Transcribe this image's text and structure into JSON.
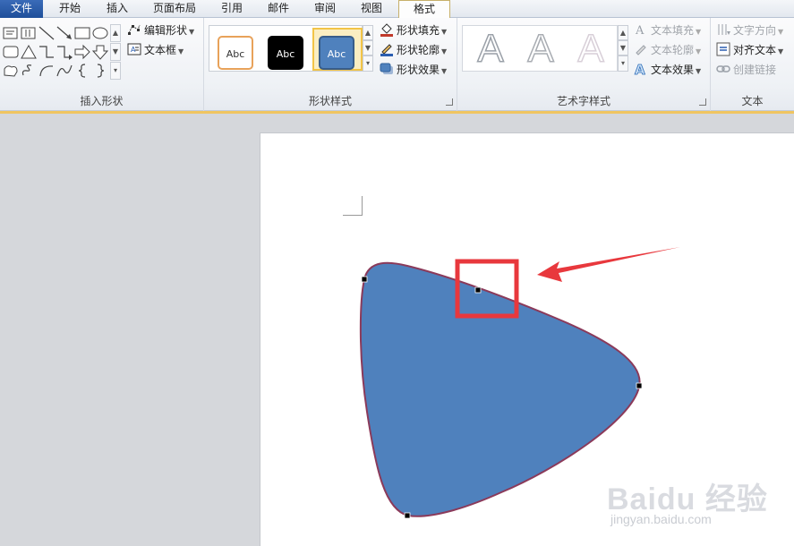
{
  "tabs": [
    {
      "label": "文件"
    },
    {
      "label": "开始"
    },
    {
      "label": "插入"
    },
    {
      "label": "页面布局"
    },
    {
      "label": "引用"
    },
    {
      "label": "邮件"
    },
    {
      "label": "审阅"
    },
    {
      "label": "视图"
    },
    {
      "label": "格式"
    }
  ],
  "active_tab": "格式",
  "groups": {
    "insert_shapes": {
      "title": "插入形状",
      "edit_shape_label": "编辑形状",
      "text_box_label": "文本框"
    },
    "shape_styles": {
      "title": "形状样式",
      "swatches": [
        {
          "label": "Abc",
          "fill": "#ffffff",
          "border": "#e8a25a",
          "text": "#333333"
        },
        {
          "label": "Abc",
          "fill": "#000000",
          "border": "#000000",
          "text": "#ffffff"
        },
        {
          "label": "Abc",
          "fill": "#4f81bd",
          "border": "#385d8a",
          "text": "#ffffff"
        }
      ],
      "fill_label": "形状填充",
      "outline_label": "形状轮廓",
      "effects_label": "形状效果"
    },
    "wordart_styles": {
      "title": "艺术字样式",
      "sample_letter": "A",
      "text_fill_label": "文本填充",
      "text_outline_label": "文本轮廓",
      "text_effects_label": "文本效果"
    },
    "text": {
      "title": "文本",
      "direction_label": "文字方向",
      "align_label": "对齐文本",
      "link_label": "创建链接"
    }
  },
  "document": {
    "shape_fill": "#4f81bd",
    "shape_outline": "#8b3a5a",
    "highlight_color": "#e8383d"
  },
  "watermark": {
    "brand": "Baidu 经验",
    "url": "jingyan.baidu.com"
  }
}
